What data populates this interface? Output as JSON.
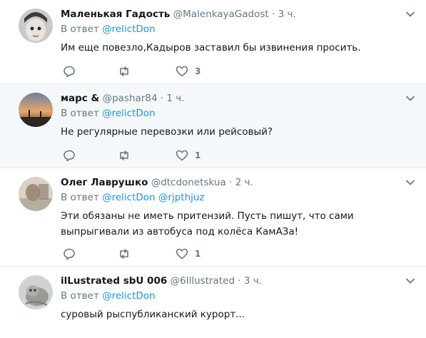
{
  "tweets": [
    {
      "name": "Маленькая Гадость",
      "handle": "@MalenkayaGadost",
      "dot": "·",
      "time": "3 ч.",
      "reply_prefix": "В ответ",
      "mentions": [
        "@relictDon"
      ],
      "text": "Им еще повезло,Кадыров заставил бы извинения просить.",
      "likes": "3"
    },
    {
      "name": "марс &",
      "handle": "@pashar84",
      "dot": "·",
      "time": "1 ч.",
      "reply_prefix": "В ответ",
      "mentions": [
        "@relictDon"
      ],
      "text": "Не регулярные перевозки или рейсовый?",
      "likes": "1"
    },
    {
      "name": "Олег Лаврушко",
      "handle": "@dtcdonetskua",
      "dot": "·",
      "time": "2 ч.",
      "reply_prefix": "В ответ",
      "mentions": [
        "@relictDon",
        "@rjpthjuz"
      ],
      "text": "Эти обязаны не иметь притензий. Пусть пишут, что сами выпрыгивали из автобуса под колёса КамАЗа!",
      "likes": "1"
    },
    {
      "name": "ilLustrated sbU 006",
      "handle": "@6Illustrated",
      "dot": "·",
      "time": "3 ч.",
      "reply_prefix": "В ответ",
      "mentions": [
        "@relictDon"
      ],
      "text": "суровый рыспубликанский курорт..."
    }
  ],
  "colors": {
    "highlight_bg": "#f5f8fa",
    "link": "#1b95e0",
    "muted": "#657786",
    "divider": "#e6ecf0"
  },
  "icons": [
    "reply-icon",
    "retweet-icon",
    "like-icon",
    "chevron-down-icon"
  ]
}
